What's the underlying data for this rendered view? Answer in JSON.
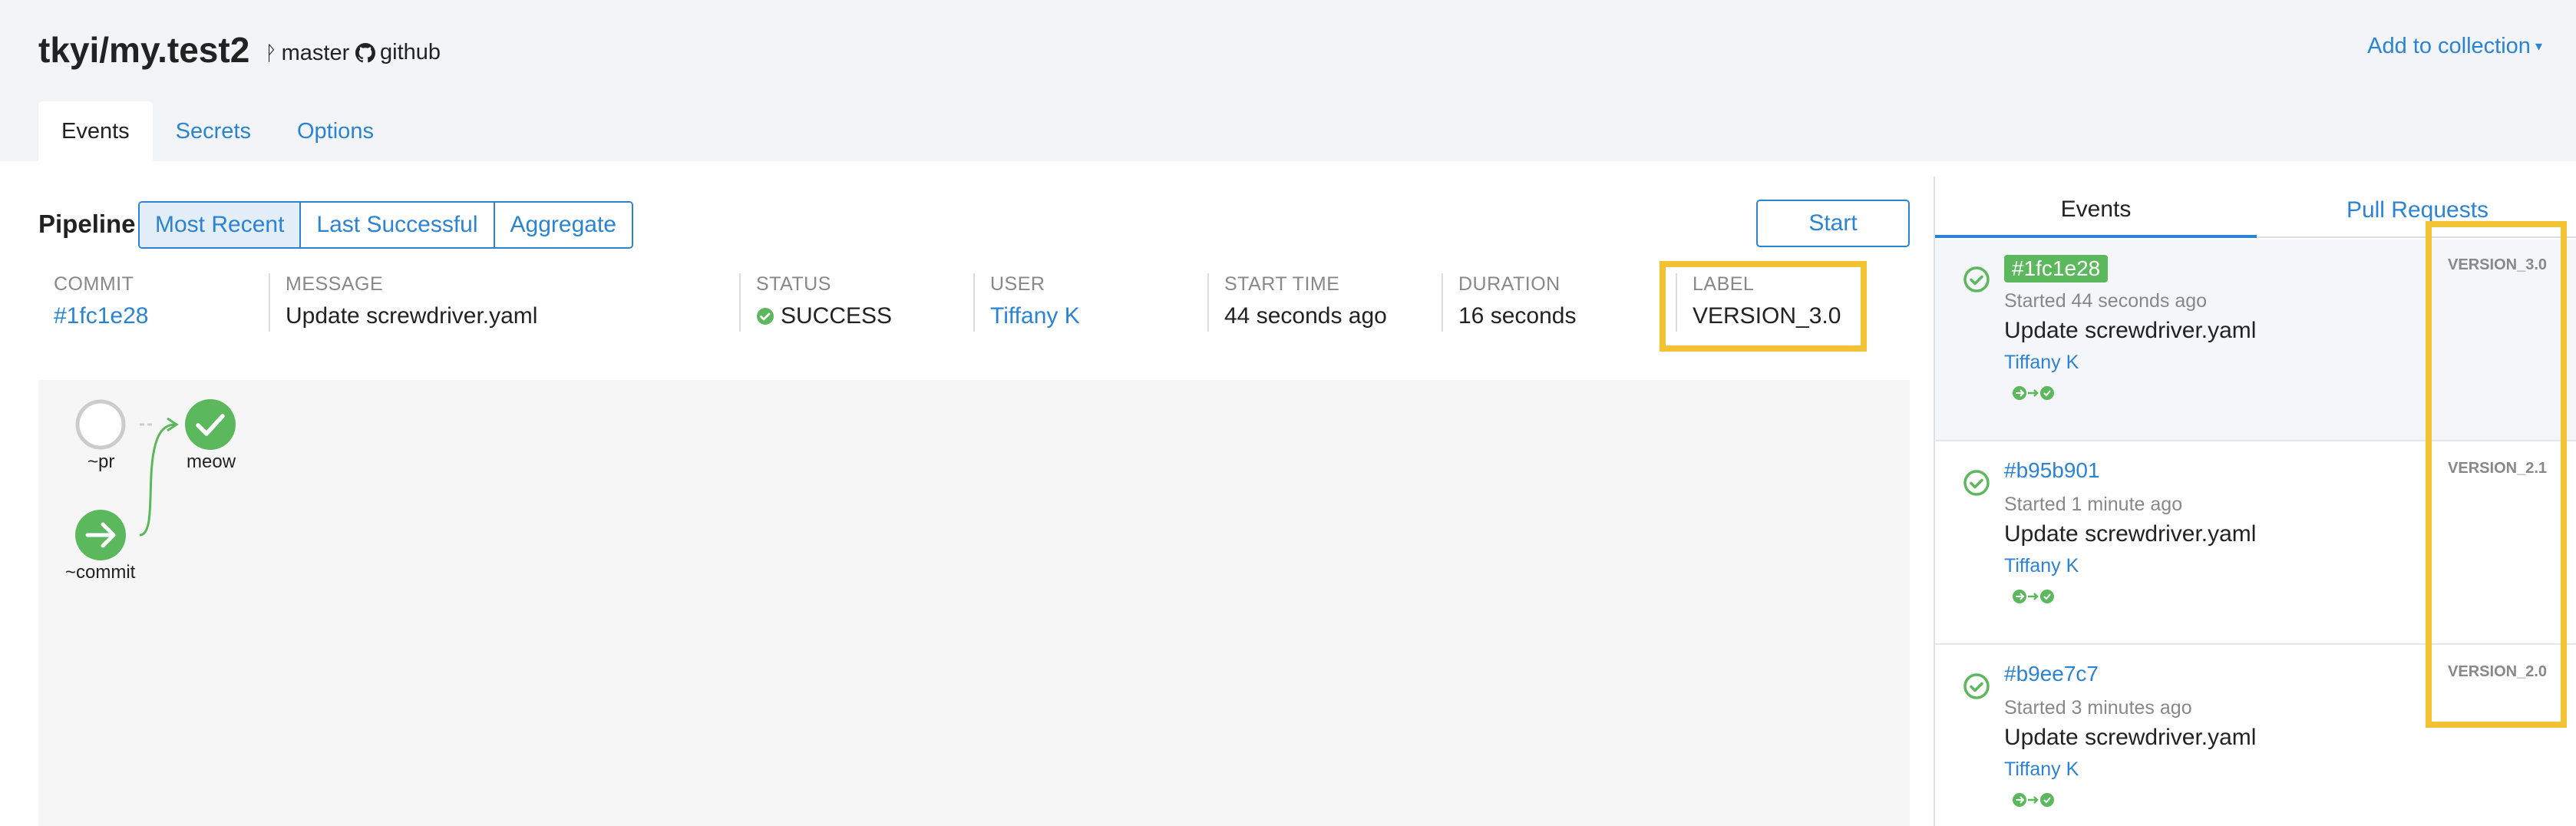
{
  "header": {
    "repo": "tkyi/my.test2",
    "branch": "master",
    "scm": "github",
    "add_collection": "Add to collection"
  },
  "tabs": [
    {
      "label": "Events",
      "active": true
    },
    {
      "label": "Secrets",
      "active": false
    },
    {
      "label": "Options",
      "active": false
    }
  ],
  "pipeline": {
    "label": "Pipeline",
    "views": [
      "Most Recent",
      "Last Successful",
      "Aggregate"
    ],
    "selected_view": "Most Recent",
    "start_label": "Start"
  },
  "info": {
    "commit_head": "COMMIT",
    "commit": "#1fc1e28",
    "message_head": "MESSAGE",
    "message": "Update screwdriver.yaml",
    "status_head": "STATUS",
    "status": "SUCCESS",
    "user_head": "USER",
    "user": "Tiffany K",
    "start_head": "START TIME",
    "start": "44 seconds ago",
    "duration_head": "DURATION",
    "duration": "16 seconds",
    "label_head": "LABEL",
    "label": "VERSION_3.0"
  },
  "graph": {
    "nodes": [
      {
        "name": "~pr",
        "state": "none"
      },
      {
        "name": "meow",
        "state": "success"
      },
      {
        "name": "~commit",
        "state": "trigger"
      }
    ]
  },
  "side": {
    "tabs": [
      "Events",
      "Pull Requests"
    ],
    "events": [
      {
        "sha": "#1fc1e28",
        "started": "Started 44 seconds ago",
        "message": "Update screwdriver.yaml",
        "user": "Tiffany K",
        "label": "VERSION_3.0"
      },
      {
        "sha": "#b95b901",
        "started": "Started 1 minute ago",
        "message": "Update screwdriver.yaml",
        "user": "Tiffany K",
        "label": "VERSION_2.1"
      },
      {
        "sha": "#b9ee7c7",
        "started": "Started 3 minutes ago",
        "message": "Update screwdriver.yaml",
        "user": "Tiffany K",
        "label": "VERSION_2.0"
      }
    ]
  },
  "colors": {
    "accent": "#2b83d3",
    "success": "#5cb85c",
    "highlight": "#f3c233"
  }
}
